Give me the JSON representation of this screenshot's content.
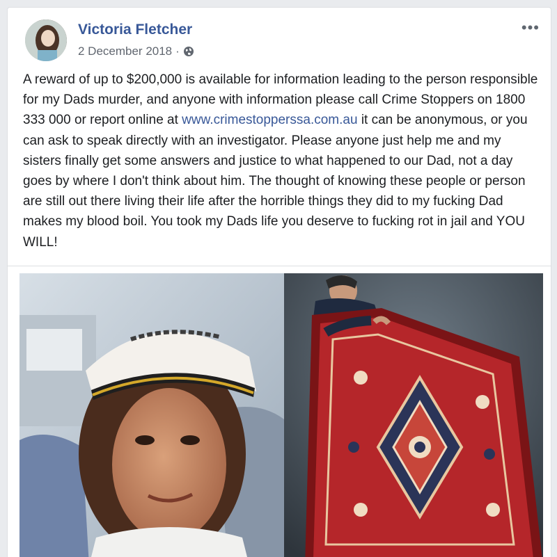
{
  "post": {
    "author_name": "Victoria Fletcher",
    "date": "2 December 2018",
    "separator": "·",
    "privacy_icon": "globe-icon",
    "more_options": "•••",
    "text_part1": "A reward of up to $200,000 is available for information leading to the person responsible for my Dads murder, and anyone with information please call Crime Stoppers on 1800 333 000 or report online at ",
    "link_text": "www.crimestopperssa.com.au",
    "text_part2": " it can be anonymous, or you can ask to speak directly with an investigator. Please anyone just help me and my sisters finally get some answers and justice to what happened to our Dad, not a day goes by where I don't think about him. The thought of knowing these people or person are still out there living their life after the horrible things they did to my fucking Dad makes my blood boil. You took my Dads life you deserve to fucking rot in jail and YOU WILL!",
    "photos": [
      {
        "subject": "man-in-white-cap"
      },
      {
        "subject": "man-holding-red-rug"
      }
    ]
  },
  "colors": {
    "link": "#385898",
    "text": "#1c1e21",
    "meta": "#616770",
    "page_bg": "#e9ebee",
    "rug_red": "#b5262a"
  }
}
